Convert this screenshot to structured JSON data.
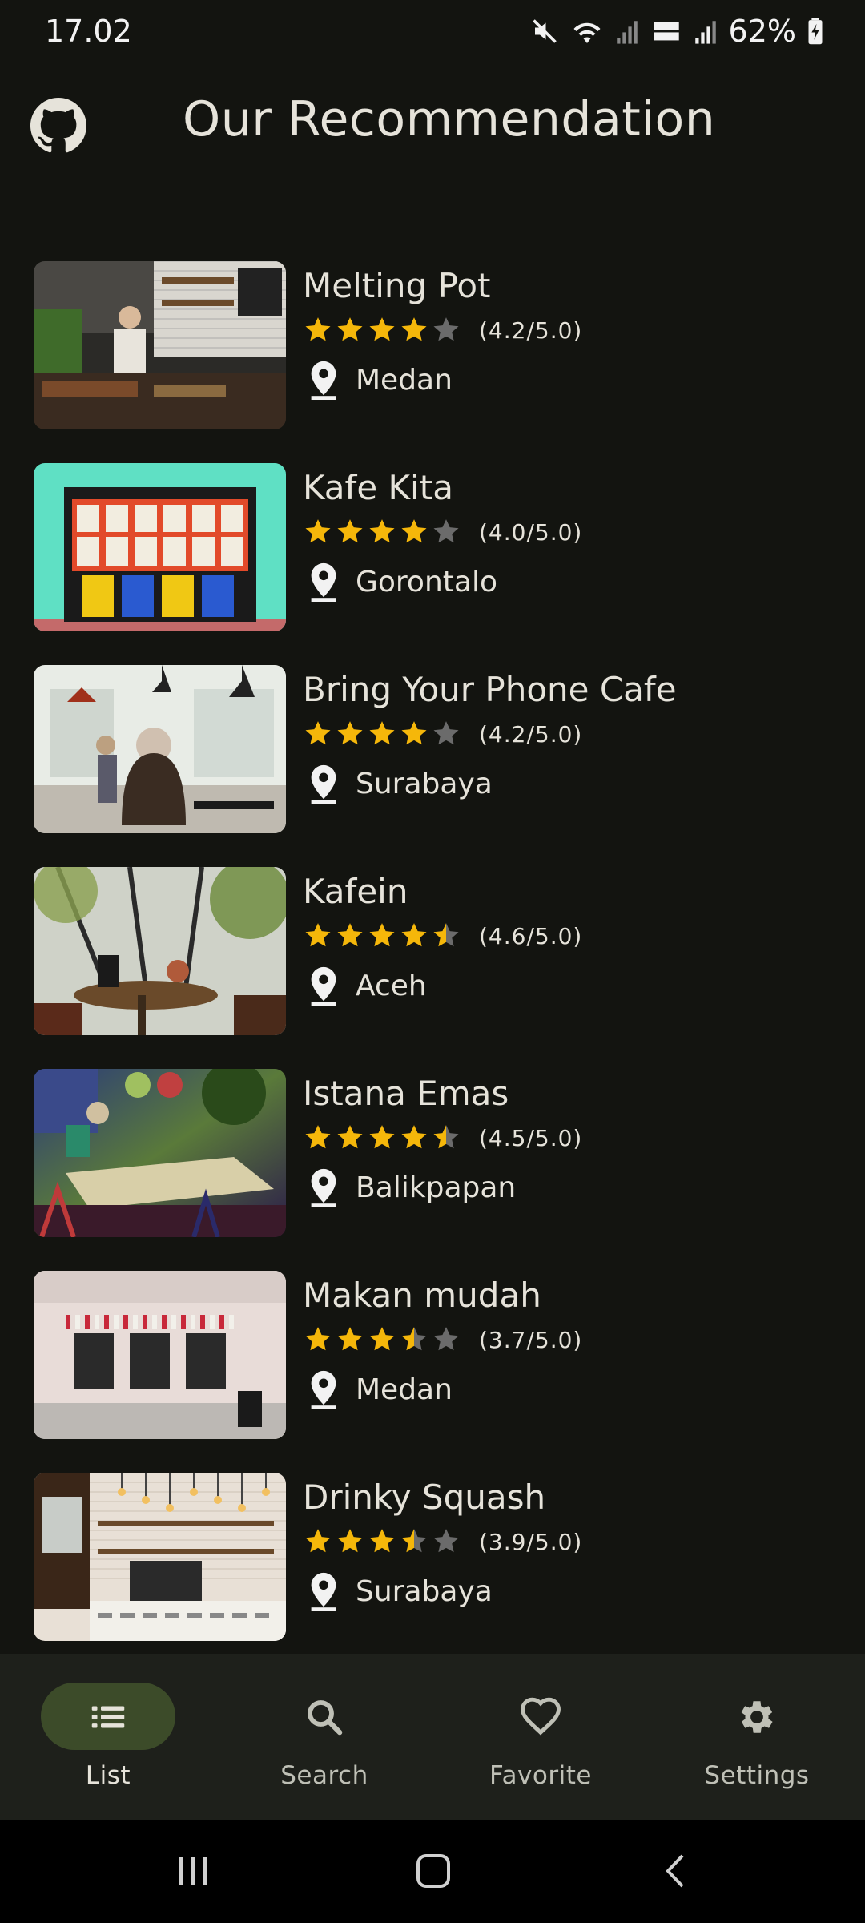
{
  "status_bar": {
    "time": "17.02",
    "battery": "62%"
  },
  "header": {
    "title": "Our Recommendation",
    "icon": "github-icon"
  },
  "cafes": [
    {
      "name": "Melting Pot",
      "rating": 4.2,
      "rating_text": "(4.2/5.0)",
      "city": "Medan"
    },
    {
      "name": "Kafe Kita",
      "rating": 4.0,
      "rating_text": "(4.0/5.0)",
      "city": "Gorontalo"
    },
    {
      "name": "Bring Your Phone Cafe",
      "rating": 4.2,
      "rating_text": "(4.2/5.0)",
      "city": "Surabaya"
    },
    {
      "name": "Kafein",
      "rating": 4.6,
      "rating_text": "(4.6/5.0)",
      "city": "Aceh"
    },
    {
      "name": "Istana Emas",
      "rating": 4.5,
      "rating_text": "(4.5/5.0)",
      "city": "Balikpapan"
    },
    {
      "name": "Makan mudah",
      "rating": 3.7,
      "rating_text": "(3.7/5.0)",
      "city": "Medan"
    },
    {
      "name": "Drinky Squash",
      "rating": 3.9,
      "rating_text": "(3.9/5.0)",
      "city": "Surabaya"
    }
  ],
  "bottom_nav": [
    {
      "label": "List",
      "icon": "list-icon",
      "active": true
    },
    {
      "label": "Search",
      "icon": "search-icon",
      "active": false
    },
    {
      "label": "Favorite",
      "icon": "heart-icon",
      "active": false
    },
    {
      "label": "Settings",
      "icon": "gear-icon",
      "active": false
    }
  ],
  "colors": {
    "background": "#131410",
    "star": "#f5b70a",
    "star_empty": "#6b6b6b",
    "nav_active": "#3c4b29"
  }
}
